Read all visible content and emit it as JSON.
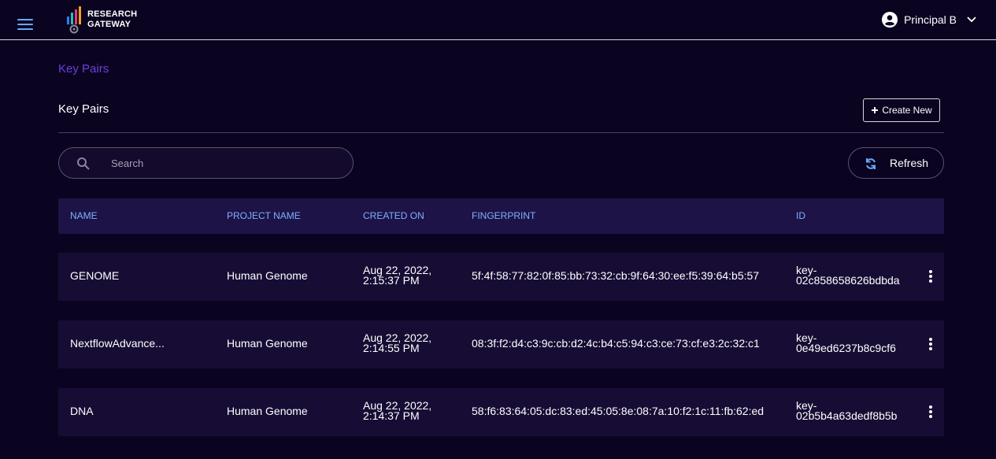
{
  "app": {
    "logo_line1": "RESEARCH",
    "logo_line2": "GATEWAY",
    "user_name": "Principal B"
  },
  "breadcrumb": "Key Pairs",
  "page_title": "Key Pairs",
  "create_label": "Create New",
  "search": {
    "placeholder": "Search",
    "value": ""
  },
  "refresh_label": "Refresh",
  "table": {
    "headers": [
      "NAME",
      "PROJECT NAME",
      "CREATED ON",
      "FINGERPRINT",
      "ID"
    ],
    "rows": [
      {
        "name": "GENOME",
        "project": "Human Genome",
        "created_line1": "Aug 22, 2022,",
        "created_line2": "2:15:37 PM",
        "fingerprint": "5f:4f:58:77:82:0f:85:bb:73:32:cb:9f:64:30:ee:f5:39:64:b5:57",
        "id_line1": "key-",
        "id_line2": "02c858658626bdbda"
      },
      {
        "name": "NextflowAdvance...",
        "project": "Human Genome",
        "created_line1": "Aug 22, 2022,",
        "created_line2": "2:14:55 PM",
        "fingerprint": "08:3f:f2:d4:c3:9c:cb:d2:4c:b4:c5:94:c3:ce:73:cf:e3:2c:32:c1",
        "id_line1": "key-",
        "id_line2": "0e49ed6237b8c9cf6"
      },
      {
        "name": "DNA",
        "project": "Human Genome",
        "created_line1": "Aug 22, 2022,",
        "created_line2": "2:14:37 PM",
        "fingerprint": "58:f6:83:64:05:dc:83:ed:45:05:8e:08:7a:10:f2:1c:11:fb:62:ed",
        "id_line1": "key-",
        "id_line2": "02b5b4a63dedf8b5b"
      }
    ]
  },
  "icons": {
    "menu": "hamburger-icon",
    "user": "account-circle-icon",
    "dropdown": "chevron-down-icon",
    "create": "plus-icon",
    "search": "search-icon",
    "refresh": "refresh-icon",
    "row_menu": "kebab-menu-icon"
  },
  "colors": {
    "background": "#0b0420",
    "row_background": "#170d34",
    "header_background": "#1d1346",
    "header_text": "#7fb0ff",
    "breadcrumb": "#6a3fe0",
    "accent_blue": "#6aa8ff"
  }
}
